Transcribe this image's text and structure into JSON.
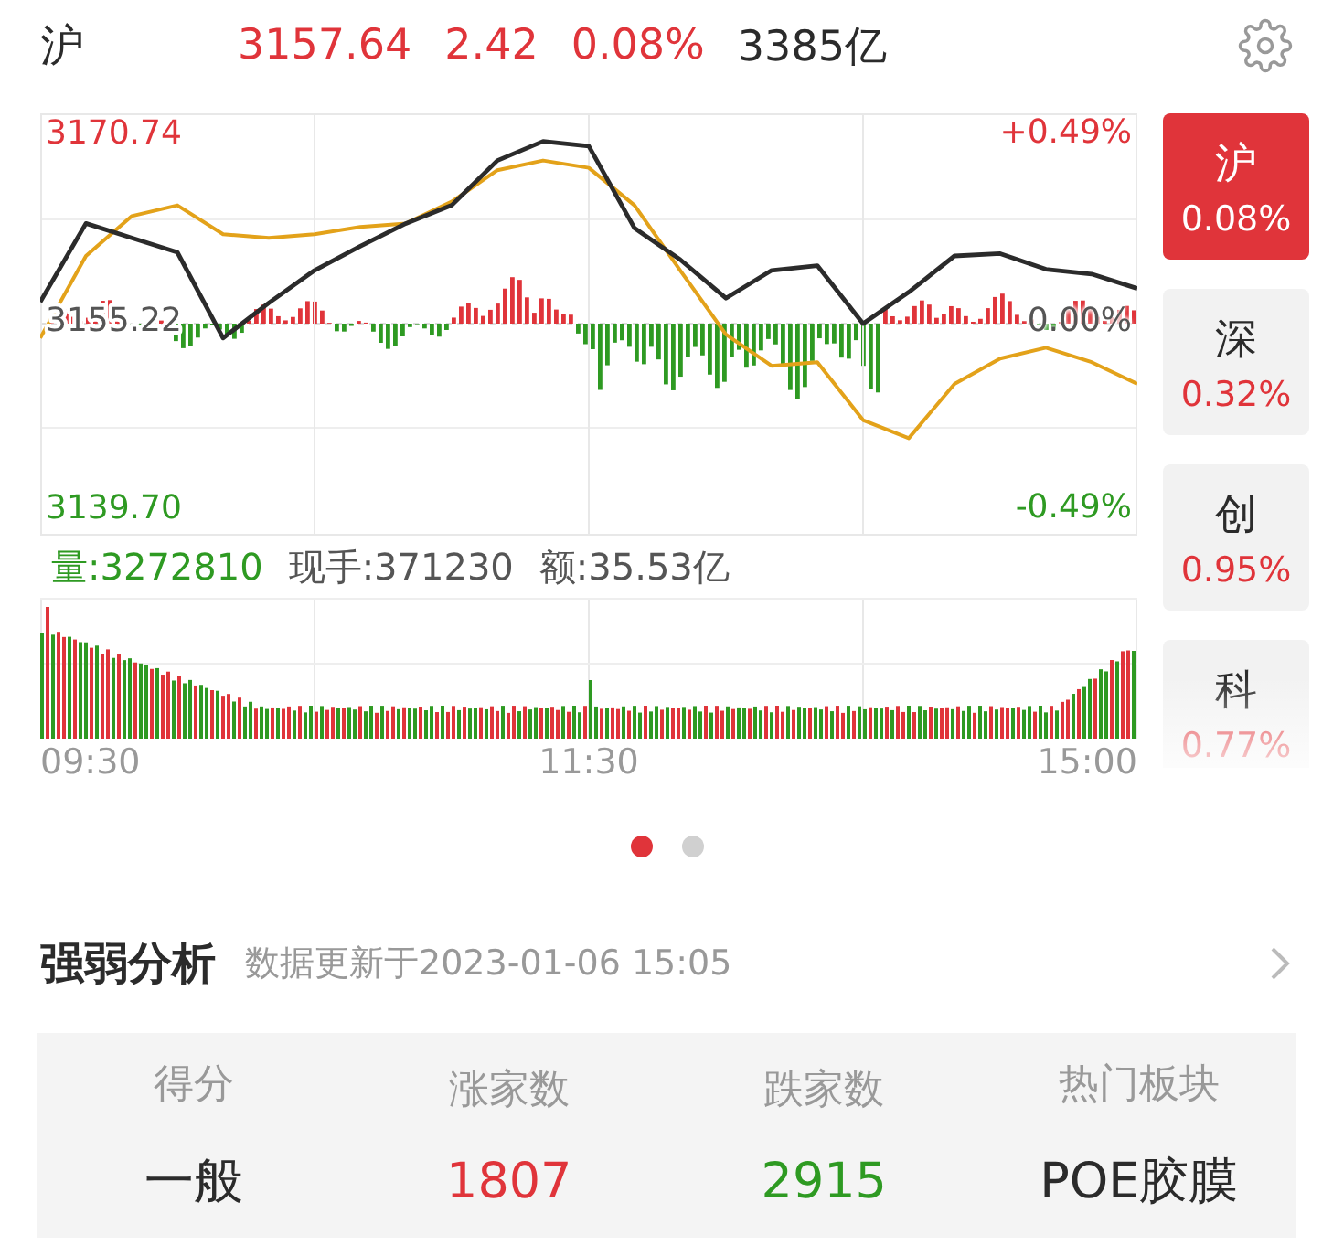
{
  "header": {
    "market": "沪",
    "price": "3157.64",
    "change": "2.42",
    "percent": "0.08%",
    "turnover": "3385亿",
    "color": "#e0343a"
  },
  "chart": {
    "max_pct": "+0.49%",
    "base_pct": "0.00%",
    "min_pct": "-0.49%",
    "chart_data": {
      "type": "line",
      "grid": true,
      "categories": [
        null,
        null,
        null,
        null,
        null,
        null,
        null,
        null,
        null,
        null,
        null,
        null,
        null,
        null,
        null,
        null,
        null,
        null,
        null,
        null,
        null,
        null,
        null,
        null,
        null
      ],
      "ylim": [
        3137.43,
        3172.41
      ],
      "yticks": [
        {
          "value": 3170.74,
          "label": "3170.74"
        },
        {
          "value": 3155.22,
          "label": "3155.22"
        },
        {
          "value": 3139.7,
          "label": "3139.70"
        }
      ],
      "series": [
        {
          "color": "#2b2b2b",
          "values": [
            3156.8,
            3163.3,
            3162.1,
            3160.9,
            3153.8,
            3156.7,
            3159.4,
            3161.4,
            3163.3,
            3164.8,
            3168.5,
            3170.1,
            3169.7,
            3162.9,
            3160.3,
            3157.1,
            3159.4,
            3159.8,
            3155.0,
            3157.6,
            3160.6,
            3160.8,
            3159.5,
            3159.1,
            3157.9
          ]
        },
        {
          "color": "#e3a21a",
          "values": [
            3153.8,
            3160.6,
            3163.9,
            3164.8,
            3162.4,
            3162.1,
            3162.4,
            3163.0,
            3163.3,
            3165.1,
            3167.7,
            3168.5,
            3167.9,
            3164.8,
            3159.4,
            3154.1,
            3151.5,
            3151.8,
            3147.0,
            3145.5,
            3150.0,
            3152.1,
            3153.0,
            3151.8,
            3150.0
          ]
        }
      ]
    }
  },
  "volume": {
    "total": "量:3272810",
    "current": "现手:371230",
    "amount": "额:35.53亿"
  },
  "time_labels": [
    "09:30",
    "11:30",
    "15:00"
  ],
  "markets": [
    {
      "label": "沪",
      "value": "0.08%",
      "selected": true
    },
    {
      "label": "深",
      "value": "0.32%",
      "selected": false
    },
    {
      "label": "创",
      "value": "0.95%",
      "selected": false
    },
    {
      "label": "科",
      "value": "0.77%",
      "selected": false
    }
  ],
  "pager": [
    {
      "selected": true
    },
    {
      "selected": false
    }
  ],
  "analysis": {
    "title": "强弱分析",
    "updated": "数据更新于2023-01-06 15:05",
    "stats": [
      {
        "label": "得分",
        "value": "一般",
        "color": "#2b2b2b"
      },
      {
        "label": "涨家数",
        "value": "1807",
        "color": "#e0343a"
      },
      {
        "label": "跌家数",
        "value": "2915",
        "color": "#2e9a22"
      },
      {
        "label": "热门板块",
        "value": "POE胶膜",
        "color": "#2b2b2b"
      }
    ]
  }
}
